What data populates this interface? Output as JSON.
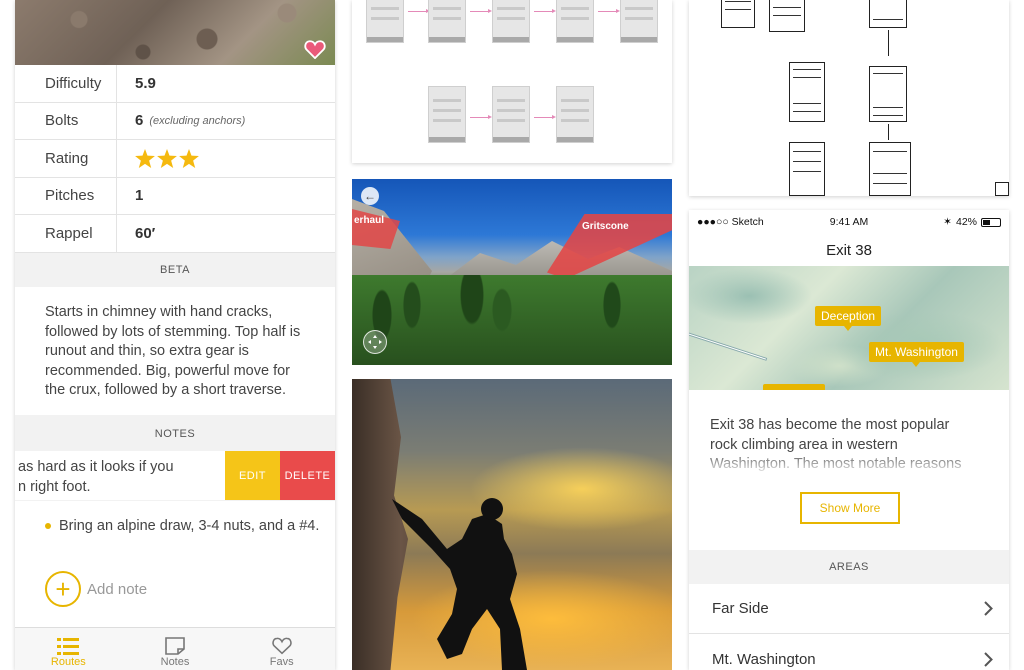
{
  "route": {
    "rows": [
      {
        "label": "Difficulty",
        "value": "5.9",
        "note": ""
      },
      {
        "label": "Bolts",
        "value": "6",
        "note": "(excluding anchors)"
      },
      {
        "label": "Rating",
        "value": "",
        "note": "",
        "stars": 3
      },
      {
        "label": "Pitches",
        "value": "1",
        "note": ""
      },
      {
        "label": "Rappel",
        "value": "60′",
        "note": ""
      }
    ],
    "beta_header": "BETA",
    "beta_text": "Starts in chimney with hand cracks, followed by lots of stemming. Top half is runout and thin, so extra gear is recommended. Big, powerful move for the crux, followed by a short traverse.",
    "notes_header": "NOTES",
    "note_swiped_line1": "as hard as it looks if you",
    "note_swiped_line2": "n right foot.",
    "edit_label": "EDIT",
    "delete_label": "DELETE",
    "note2": "Bring an alpine draw, 3-4 nuts, and a #4.",
    "add_note_label": "Add note",
    "tabs": [
      {
        "label": "Routes",
        "icon": "list-icon",
        "active": true
      },
      {
        "label": "Notes",
        "icon": "note-icon",
        "active": false
      },
      {
        "label": "Favs",
        "icon": "heart-icon",
        "active": false
      }
    ],
    "accent_color": "#e7b500",
    "delete_color": "#e94b4b"
  },
  "valley_photo": {
    "label_left": "erhaul",
    "label_right": "Gritscone"
  },
  "area": {
    "status": {
      "carrier": "●●●○○ Sketch",
      "time": "9:41 AM",
      "battery": "42%"
    },
    "title": "Exit 38",
    "pins": [
      "Deception",
      "Mt. Washington"
    ],
    "description": "Exit 38 has become the most popular rock climbing area in western Washington. The most notable reasons",
    "show_more": "Show More",
    "areas_header": "AREAS",
    "areas": [
      "Far Side",
      "Mt. Washington"
    ]
  }
}
